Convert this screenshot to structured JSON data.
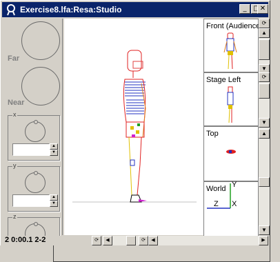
{
  "window": {
    "title": "Exercise8.lfa:Resa:Studio",
    "buttons": {
      "minimize": "_",
      "maximize": "□",
      "close": "✕"
    }
  },
  "left_panel": {
    "far_label": "Far",
    "near_label": "Near",
    "groups": [
      {
        "axis": "x",
        "value": ""
      },
      {
        "axis": "y",
        "value": ""
      },
      {
        "axis": "z",
        "value": ""
      }
    ]
  },
  "views": [
    {
      "label": "Front (Audience)"
    },
    {
      "label": "Stage Left"
    },
    {
      "label": "Top"
    },
    {
      "label": "World"
    }
  ],
  "world_axes": {
    "y": "Y",
    "z": "Z",
    "x": "X"
  },
  "status": {
    "text": "2 0:00.1 2-2"
  },
  "colors": {
    "title_bg": "#0a246a",
    "figure_red": "#e02020",
    "figure_yellow": "#e0c000",
    "figure_blue": "#2030c0",
    "figure_green": "#20a020",
    "figure_magenta": "#d020d0"
  }
}
